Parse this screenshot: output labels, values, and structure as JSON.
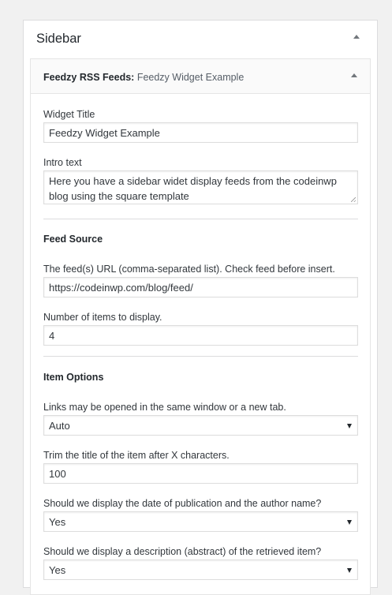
{
  "sidebar": {
    "title": "Sidebar"
  },
  "widget": {
    "title_prefix": "Feedzy RSS Feeds:",
    "title_name": "Feedzy Widget Example"
  },
  "form": {
    "widget_title": {
      "label": "Widget Title",
      "value": "Feedzy Widget Example"
    },
    "intro_text": {
      "label": "Intro text",
      "value": "Here you have a sidebar widet display feeds from the codeinwp blog using the square template"
    },
    "feed_source": {
      "heading": "Feed Source",
      "url_label": "The feed(s) URL (comma-separated list). Check feed before insert.",
      "url_value": "https://codeinwp.com/blog/feed/",
      "items_label": "Number of items to display.",
      "items_value": "4"
    },
    "item_options": {
      "heading": "Item Options",
      "links_label": "Links may be opened in the same window or a new tab.",
      "links_value": "Auto",
      "trim_label": "Trim the title of the item after X characters.",
      "trim_value": "100",
      "date_label": "Should we display the date of publication and the author name?",
      "date_value": "Yes",
      "desc_label": "Should we display a description (abstract) of the retrieved item?",
      "desc_value": "Yes"
    }
  },
  "icons": {
    "collapse": "caret-up-icon",
    "select": "caret-down-icon"
  }
}
